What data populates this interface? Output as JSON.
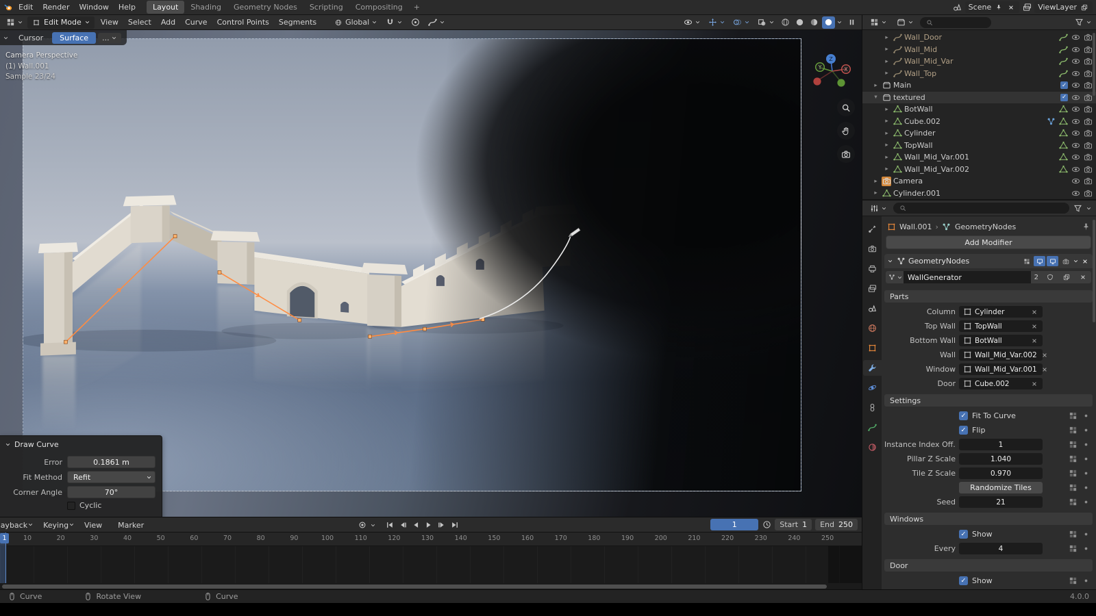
{
  "colors": {
    "accent_blue": "#4772b3",
    "handle_orange": "#ff8c42",
    "object_orange": "#e8883a",
    "data_green": "#54b06a"
  },
  "topbar": {
    "menus": [
      "Edit",
      "Render",
      "Window",
      "Help"
    ],
    "workspaces": [
      "Layout",
      "Shading",
      "Geometry Nodes",
      "Scripting",
      "Compositing"
    ],
    "active_workspace": "Layout",
    "new_workspace_button": "+",
    "scene_label": "Scene",
    "view_layer_label": "ViewLayer"
  },
  "viewport": {
    "header": {
      "mode": "Edit Mode",
      "menus": [
        "View",
        "Select",
        "Add",
        "Curve",
        "Control Points",
        "Segments"
      ],
      "orientation": "Global"
    },
    "toolbar": {
      "tabs": [
        "Cursor",
        "Surface"
      ],
      "active_tab": "Surface",
      "more_button": "..."
    },
    "overlay_lines": [
      "Camera Perspective",
      "(1) Wall.001",
      "Sample 23/24"
    ],
    "gizmo_axes": {
      "x": "X",
      "y": "Y",
      "z": "Z"
    }
  },
  "draw_curve_panel": {
    "title": "Draw Curve",
    "error_label": "Error",
    "error_value": "0.1861 m",
    "fit_method_label": "Fit Method",
    "fit_method_value": "Refit",
    "corner_angle_label": "Corner Angle",
    "corner_angle_value": "70°",
    "cyclic_label": "Cyclic",
    "cyclic_checked": false
  },
  "timeline": {
    "menus": [
      "Playback",
      "Keying",
      "View",
      "Marker"
    ],
    "transport": [
      "jump-start",
      "prev-keyframe",
      "play-reverse",
      "play",
      "next-keyframe",
      "jump-end"
    ],
    "current_frame": "1",
    "start_label": "Start",
    "start_value": "1",
    "end_label": "End",
    "end_value": "250",
    "ticks": [
      10,
      20,
      30,
      40,
      50,
      60,
      70,
      80,
      90,
      100,
      110,
      120,
      130,
      140,
      150,
      160,
      170,
      180,
      190,
      200,
      210,
      220,
      230,
      240,
      250
    ]
  },
  "status_bar": {
    "left_hint": "Curve",
    "middle_hints": [
      "Rotate View",
      "Curve"
    ],
    "version": "4.0.0"
  },
  "outliner": {
    "items": [
      {
        "label": "Wall_Door",
        "icon": "curve-data",
        "indent": 1,
        "dim": true,
        "right_icons": [
          "curve-data"
        ]
      },
      {
        "label": "Wall_Mid",
        "icon": "curve-data",
        "indent": 1,
        "dim": true,
        "right_icons": [
          "curve-data"
        ]
      },
      {
        "label": "Wall_Mid_Var",
        "icon": "curve-data",
        "indent": 1,
        "dim": true,
        "right_icons": [
          "curve-data"
        ]
      },
      {
        "label": "Wall_Top",
        "icon": "curve-data",
        "indent": 1,
        "dim": true,
        "right_icons": [
          "curve-data"
        ]
      },
      {
        "label": "Main",
        "icon": "collection",
        "indent": 0,
        "checkbox": true,
        "right_icons": []
      },
      {
        "label": "textured",
        "icon": "collection",
        "indent": 0,
        "checkbox": true,
        "highlight": true,
        "expanded": true,
        "right_icons": []
      },
      {
        "label": "BotWall",
        "icon": "mesh-data",
        "indent": 1,
        "right_icons": [
          "mesh-data"
        ]
      },
      {
        "label": "Cube.002",
        "icon": "mesh-data",
        "indent": 1,
        "right_icons": [
          "nodes",
          "mesh-data"
        ]
      },
      {
        "label": "Cylinder",
        "icon": "mesh-data",
        "indent": 1,
        "right_icons": [
          "mesh-data"
        ]
      },
      {
        "label": "TopWall",
        "icon": "mesh-data",
        "indent": 1,
        "right_icons": [
          "mesh-data"
        ]
      },
      {
        "label": "Wall_Mid_Var.001",
        "icon": "mesh-data",
        "indent": 1,
        "right_icons": [
          "mesh-data"
        ]
      },
      {
        "label": "Wall_Mid_Var.002",
        "icon": "mesh-data",
        "indent": 1,
        "right_icons": [
          "mesh-data"
        ]
      },
      {
        "label": "Camera",
        "icon": "camera",
        "indent": 0,
        "selected": true,
        "right_icons": []
      },
      {
        "label": "Cylinder.001",
        "icon": "mesh-data",
        "indent": 0,
        "right_icons": []
      }
    ]
  },
  "properties": {
    "tabs": [
      "tool",
      "render",
      "output",
      "view-layer",
      "scene",
      "world",
      "object",
      "modifiers",
      "physics",
      "constraints",
      "data",
      "material"
    ],
    "active_tab": "modifiers",
    "breadcrumb": {
      "object": "Wall.001",
      "separator": "›",
      "datablock": "GeometryNodes"
    },
    "add_modifier_button": "Add Modifier",
    "modifier": {
      "name": "GeometryNodes",
      "node_group": "WallGenerator",
      "users_count": "2"
    },
    "panels": [
      {
        "title": "Parts",
        "rows": [
          {
            "type": "object",
            "label": "Column",
            "value": "Cylinder"
          },
          {
            "type": "object",
            "label": "Top Wall",
            "value": "TopWall"
          },
          {
            "type": "object",
            "label": "Bottom Wall",
            "value": "BotWall"
          },
          {
            "type": "object",
            "label": "Wall",
            "value": "Wall_Mid_Var.002"
          },
          {
            "type": "object",
            "label": "Window",
            "value": "Wall_Mid_Var.001"
          },
          {
            "type": "object",
            "label": "Door",
            "value": "Cube.002"
          }
        ]
      },
      {
        "title": "Settings",
        "rows": [
          {
            "type": "checkbox",
            "label": "Fit To Curve",
            "checked": true
          },
          {
            "type": "checkbox",
            "label": "Flip",
            "checked": true
          },
          {
            "type": "number",
            "label": "Instance Index Off...",
            "value": "1"
          },
          {
            "type": "number",
            "label": "Pillar Z Scale",
            "value": "1.040"
          },
          {
            "type": "number",
            "label": "Tile Z Scale",
            "value": "0.970"
          },
          {
            "type": "button",
            "label": "",
            "value": "Randomize Tiles"
          },
          {
            "type": "number",
            "label": "Seed",
            "value": "21"
          }
        ]
      },
      {
        "title": "Windows",
        "rows": [
          {
            "type": "checkbox",
            "label": "Show",
            "checked": true
          },
          {
            "type": "number",
            "label": "Every",
            "value": "4"
          }
        ]
      },
      {
        "title": "Door",
        "rows": [
          {
            "type": "checkbox",
            "label": "Show",
            "checked": true
          }
        ]
      }
    ]
  }
}
